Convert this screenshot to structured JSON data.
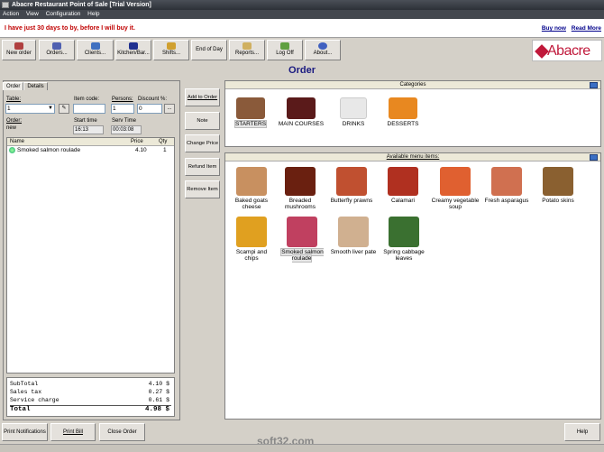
{
  "window": {
    "title": "Abacre Restaurant Point of Sale [Trial Version]"
  },
  "menu": [
    "Action",
    "View",
    "Configuration",
    "Help"
  ],
  "trial": {
    "message": "I have just 30 days to by, before I will buy it.",
    "buy_now": "Buy now",
    "read_more": "Read More"
  },
  "toolbar": [
    {
      "label": "New order",
      "color": "#b04040"
    },
    {
      "label": "Orders...",
      "color": "#5060b0"
    },
    {
      "label": "Clients...",
      "color": "#4070c0"
    },
    {
      "label": "Kitchen/Bar...",
      "color": "#203090"
    },
    {
      "label": "Shifts...",
      "color": "#d0a030"
    },
    {
      "label": "End of Day",
      "color": "#e4e1dc"
    },
    {
      "label": "Reports...",
      "color": "#d0b060"
    },
    {
      "label": "Log Off",
      "color": "#60a040"
    },
    {
      "label": "About...",
      "color": "#4060c0"
    }
  ],
  "logo": "Abacre",
  "order_title": "Order",
  "tabs": [
    "Order",
    "Details"
  ],
  "form": {
    "table_label": "Table:",
    "table_value": "1",
    "item_code_label": "Item code:",
    "item_code_value": "",
    "persons_label": "Persons:",
    "persons_value": "1",
    "discount_label": "Discount %:",
    "discount_value": "0",
    "order_label": "Order:",
    "order_value": "new",
    "start_label": "Start time",
    "start_value": "16:13",
    "serv_label": "Serv Time",
    "serv_value": "00:03:08",
    "more_button": "..."
  },
  "grid": {
    "headers": {
      "name": "Name",
      "price": "Price",
      "qty": "Qty"
    },
    "rows": [
      {
        "name": "Smoked salmon roulade",
        "price": "4.10",
        "qty": "1"
      }
    ]
  },
  "totals": [
    {
      "label": "SubTotal",
      "value": "4.10 $"
    },
    {
      "label": "Sales tax",
      "value": "0.27 $"
    },
    {
      "label": "Service charge",
      "value": "0.61 $"
    },
    {
      "label": "Total",
      "value": "4.98 $"
    }
  ],
  "side_buttons": [
    "Add to Order",
    "Note",
    "Change Price",
    "Refund Item",
    "Remove Item"
  ],
  "categories": {
    "title": "Categories",
    "items": [
      {
        "label": "STARTERS",
        "color": "#8a5a3a"
      },
      {
        "label": "MAIN COURSES",
        "color": "#5a1a1a"
      },
      {
        "label": "DRINKS",
        "color": "#e8e8e8"
      },
      {
        "label": "DESSERTS",
        "color": "#e88820"
      }
    ]
  },
  "menu_items": {
    "title": "Available menu items:",
    "items": [
      {
        "label": "Baked goats cheese",
        "color": "#c89060"
      },
      {
        "label": "Breaded mushrooms",
        "color": "#6a2010"
      },
      {
        "label": "Butterfly prawns",
        "color": "#c05030"
      },
      {
        "label": "Calamari",
        "color": "#b03020"
      },
      {
        "label": "Creamy vegetable soup",
        "color": "#e06030"
      },
      {
        "label": "Fresh asparagus",
        "color": "#d07050"
      },
      {
        "label": "Potato skins",
        "color": "#8a6030"
      },
      {
        "label": "Scampi and chips",
        "color": "#e0a020"
      },
      {
        "label": "Smoked salmon roulade",
        "color": "#c04060"
      },
      {
        "label": "Smooth liver pate",
        "color": "#d0b090"
      },
      {
        "label": "Spring cabbage leaves",
        "color": "#3a7030"
      }
    ]
  },
  "bottom_buttons": [
    "Print Notifications",
    "Print Bill",
    "Close Order"
  ],
  "help_button": "Help",
  "watermark": "soft32.com"
}
